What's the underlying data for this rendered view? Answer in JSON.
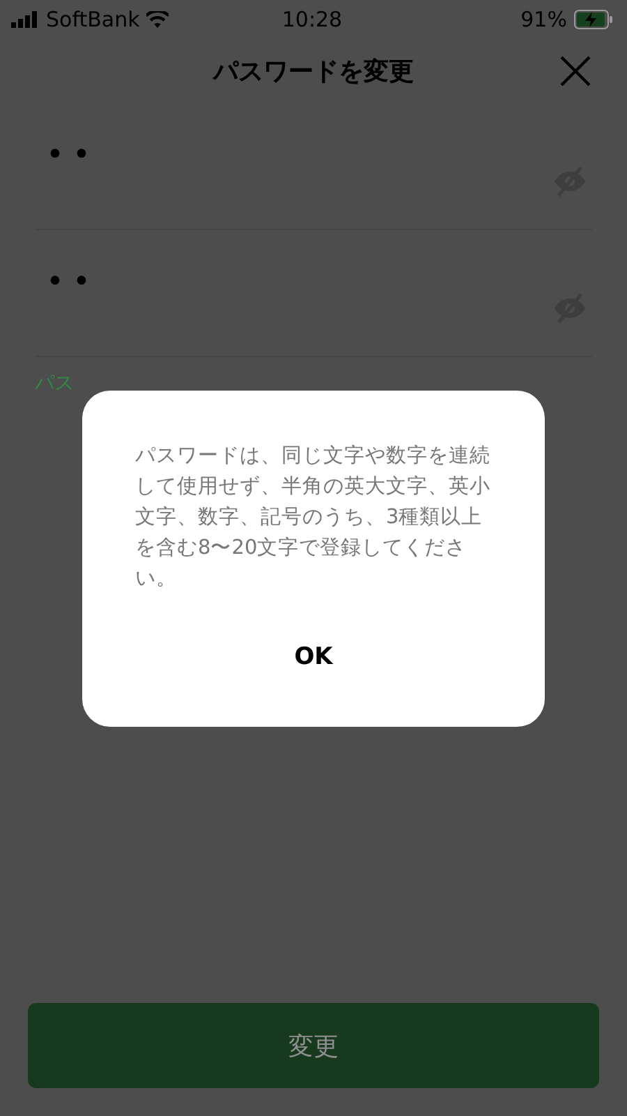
{
  "status_bar": {
    "carrier": "SoftBank",
    "time": "10:28",
    "battery": "91%"
  },
  "header": {
    "title": "パスワードを変更"
  },
  "fields": [
    {
      "value": "••",
      "revealed": false
    },
    {
      "value": "••",
      "revealed": false
    }
  ],
  "hint": "パス",
  "submit": {
    "label": "変更"
  },
  "dialog": {
    "message": "パスワードは、同じ文字や数字を連続して使用せず、半角の英大文字、英小文字、数字、記号のうち、3種類以上を含む8〜20文字で登録してください。",
    "button": "OK"
  }
}
